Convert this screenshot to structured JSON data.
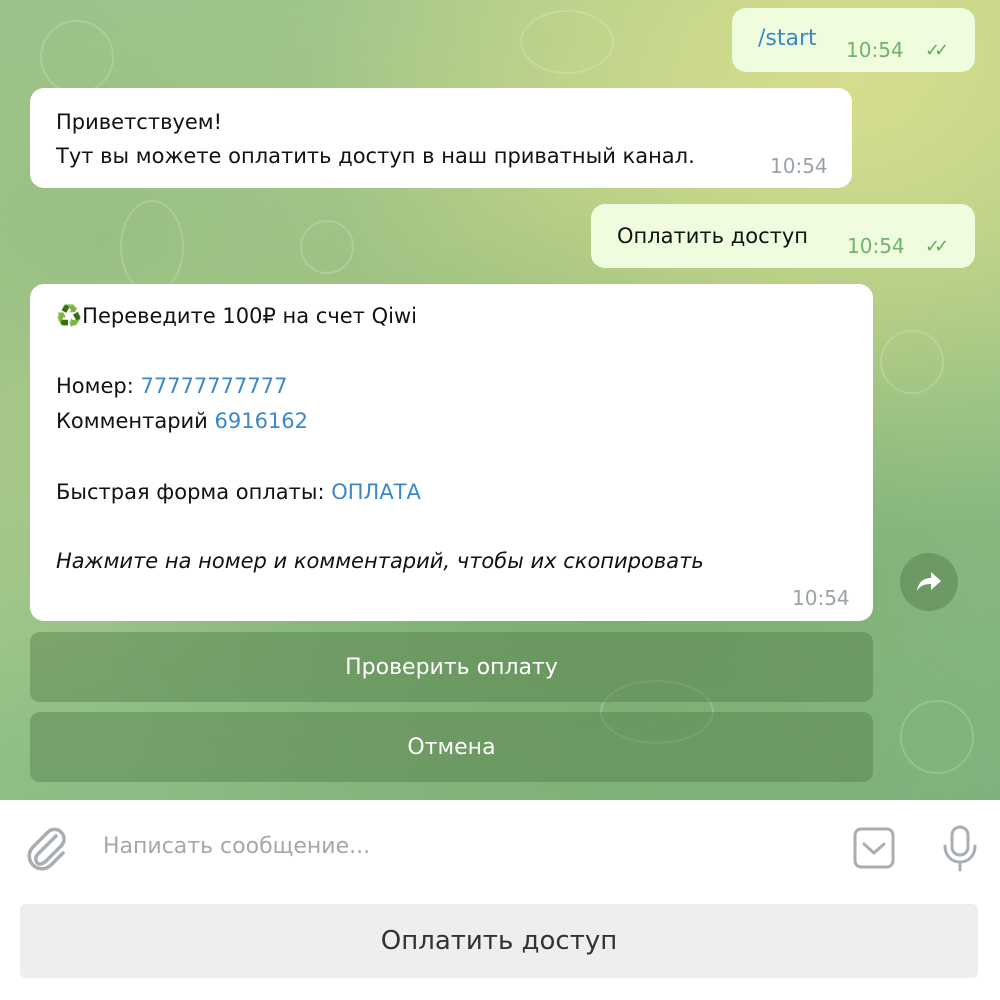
{
  "messages": {
    "m1": {
      "text": "/start",
      "time": "10:54",
      "ticks": "✓✓"
    },
    "m2": {
      "line1": "Приветствуем!",
      "line2": "Тут вы можете оплатить доступ в наш приватный канал.",
      "time": "10:54"
    },
    "m3": {
      "text": "Оплатить доступ",
      "time": "10:54",
      "ticks": "✓✓"
    },
    "m4": {
      "icon": "♻️",
      "title": "Переведите 100₽ на счет Qiwi",
      "number_label": "Номер: ",
      "number_value": "77777777777",
      "comment_label": "Комментарий ",
      "comment_value": "6916162",
      "fastform_label": "Быстрая форма оплаты: ",
      "fastform_link": "ОПЛАТА",
      "hint": "Нажмите на номер и комментарий, чтобы их скопировать",
      "time": "10:54"
    }
  },
  "inline_keyboard": {
    "check": "Проверить оплату",
    "cancel": "Отмена"
  },
  "composer": {
    "placeholder": "Написать сообщение..."
  },
  "reply_keyboard": {
    "button": "Оплатить доступ"
  },
  "colors": {
    "outgoing_bubble": "#effdde",
    "incoming_bubble": "#ffffff",
    "link": "#3a88c8",
    "checkmarks": "#5cb15a"
  },
  "icons": {
    "attach": "paperclip-icon",
    "emoji": "sticker-icon",
    "voice": "microphone-icon",
    "forward": "forward-arrow-icon"
  }
}
